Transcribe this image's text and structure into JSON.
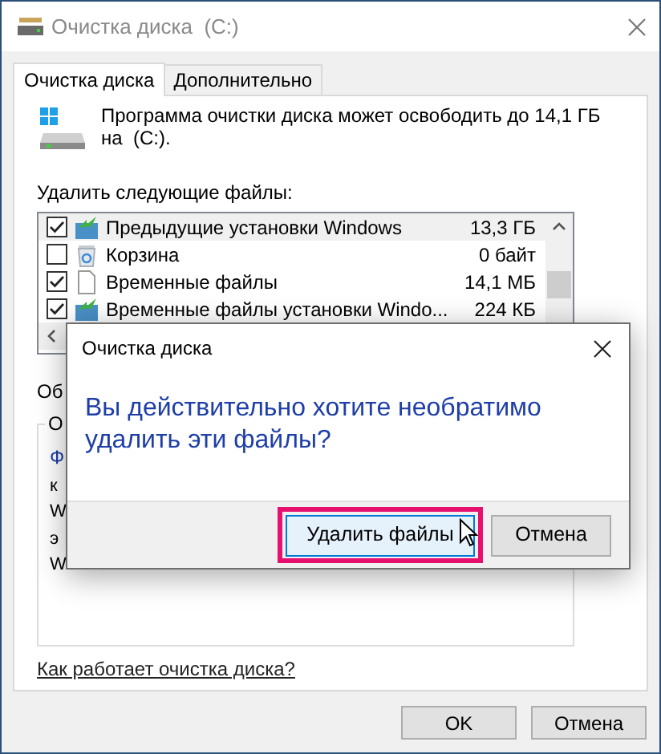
{
  "window": {
    "title": "Очистка диска  (C:)"
  },
  "tabs": [
    {
      "label": "Очистка диска",
      "selected": true
    },
    {
      "label": "Дополнительно",
      "selected": false
    }
  ],
  "summary": "Программа очистки диска может освободить до 14,1 ГБ на  (C:).",
  "files_label": "Удалить следующие файлы:",
  "files": [
    {
      "name": "Предыдущие установки Windows",
      "size": "13,3 ГБ",
      "checked": true,
      "selected": true,
      "kind": "setup"
    },
    {
      "name": "Корзина",
      "size": "0 байт",
      "checked": false,
      "selected": false,
      "kind": "bin"
    },
    {
      "name": "Временные файлы",
      "size": "14,1 МБ",
      "checked": true,
      "selected": false,
      "kind": "file"
    },
    {
      "name": "Временные файлы установки Windo...",
      "size": "224 КБ",
      "checked": true,
      "selected": false,
      "kind": "setup"
    }
  ],
  "description_label": "Об",
  "group": {
    "label": "О",
    "lines": [
      {
        "text": "Ф",
        "kind": "title"
      },
      {
        "text": "к",
        "kind": "body"
      },
      {
        "text": "W",
        "kind": "body"
      },
      {
        "text": "э",
        "kind": "body"
      },
      {
        "text": "W",
        "kind": "body"
      }
    ]
  },
  "help_link": "Как работает очистка диска?",
  "buttons": [
    "OK",
    "Отмена"
  ],
  "dialog": {
    "title": "Очистка диска",
    "message": "Вы действительно хотите необратимо удалить эти файлы?",
    "buttons": [
      {
        "label": "Удалить файлы",
        "default": true,
        "highlighted": true
      },
      {
        "label": "Отмена",
        "default": false,
        "highlighted": false
      }
    ]
  }
}
